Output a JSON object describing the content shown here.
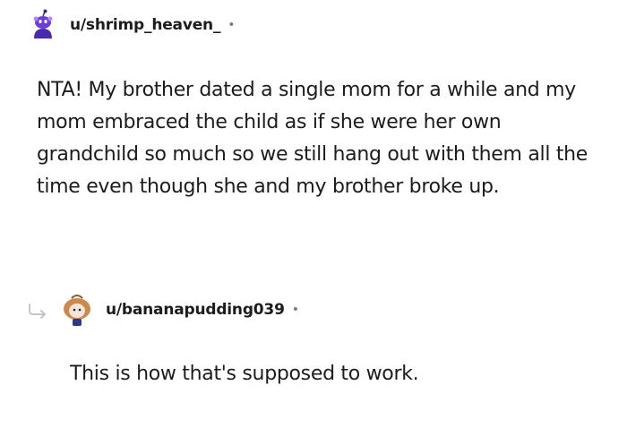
{
  "comments": [
    {
      "username": "u/shrimp_heaven_",
      "separator": "•",
      "body": "NTA! My brother dated a single mom for a while and my mom embraced the child as if she were her own grandchild so much so we still hang out with them all the time even though she and my brother broke up.",
      "avatar_icon": "snoo-avatar-icon",
      "avatar_color": "#6b3fd6"
    },
    {
      "username": "u/bananapudding039",
      "separator": "•",
      "body": "This is how that's supposed to work.",
      "avatar_icon": "snoo-avatar-icon",
      "avatar_color": "#c98a4b",
      "reply_indicator_icon": "reply-arrow-icon"
    }
  ],
  "colors": {
    "text": "#1c1c1c",
    "meta": "#7c7c7c",
    "reply_arrow": "#c6c6c6"
  }
}
